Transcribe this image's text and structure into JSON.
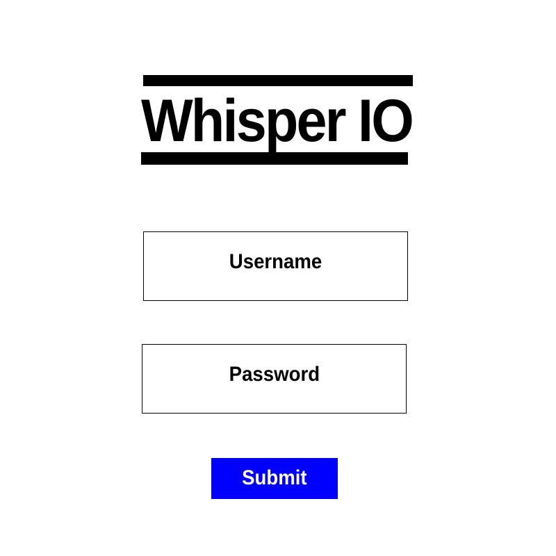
{
  "logo": {
    "text": "Whisper IO"
  },
  "form": {
    "username_label": "Username",
    "password_label": "Password",
    "submit_label": "Submit"
  },
  "colors": {
    "background": "#ffffff",
    "text": "#000000",
    "submit_background": "#0000ff",
    "submit_text": "#ffffff"
  }
}
